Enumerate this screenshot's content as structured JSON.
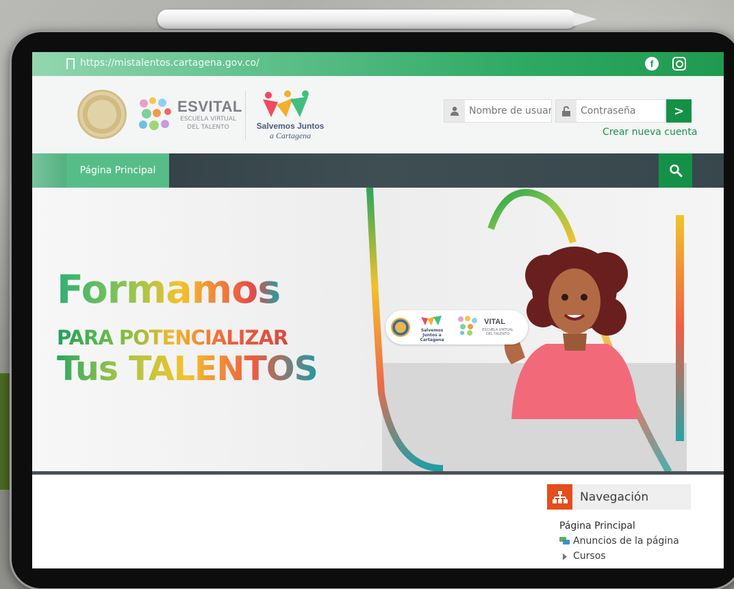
{
  "browser": {
    "url": "https://mistalentos.cartagena.gov.co/"
  },
  "header": {
    "esvital_title": "ESVITAL",
    "esvital_sub1": "ESCUELA VIRTUAL",
    "esvital_sub2": "DEL TALENTO",
    "salvemos_line1": "Salvemos Juntos",
    "salvemos_line2": "a Cartagena"
  },
  "login": {
    "username_placeholder": "Nombre de usuario",
    "password_placeholder": "Contraseña",
    "submit_label": ">",
    "create_account": "Crear nueva cuenta"
  },
  "nav": {
    "home_label": "Página Principal"
  },
  "hero": {
    "line1": "Formamos",
    "line2": "PARA POTENCIALIZAR",
    "line3": "Tus TALENTOS",
    "badge_salvemos": "Salvemos Juntos a Cartagena",
    "badge_vital": "VITAL",
    "badge_vital_sub": "ESCUELA VIRTUAL DEL TALENTO"
  },
  "navigation_block": {
    "title": "Navegación",
    "items": [
      "Página Principal",
      "Anuncios de la página",
      "Cursos"
    ]
  },
  "colors": {
    "brand_green": "#159147",
    "nav_dark": "#37474c",
    "nav_icon": "#e74c1c"
  },
  "icons": [
    "bookmark-icon",
    "facebook-icon",
    "instagram-icon",
    "user-icon",
    "lock-icon",
    "search-icon",
    "sitemap-icon",
    "forum-icon",
    "caret-right-icon"
  ]
}
